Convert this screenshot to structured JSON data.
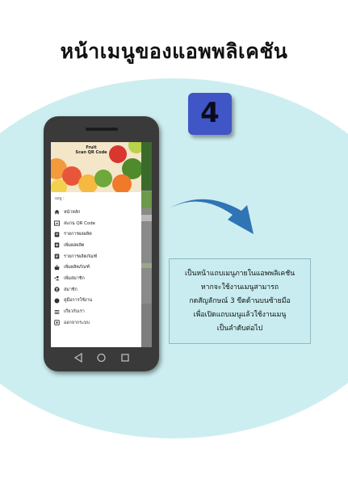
{
  "title": "หน้าเมนูของแอพพลิเคชัน",
  "step_number": "4",
  "colors": {
    "background": "#ffffff",
    "circle": "#cdeef0",
    "badge": "#4056c6",
    "arrow": "#2f74b5",
    "info_box": "#c8ecf0"
  },
  "phone": {
    "header_text": [
      "Fruit",
      "Scan QR Code"
    ],
    "menu_heading": "เมนู :",
    "menu_items": [
      {
        "label": "หน้าหลัก",
        "icon": "home-icon"
      },
      {
        "label": "สแกน QR Code",
        "icon": "qr-scan-icon"
      },
      {
        "label": "รายการผลผลิต",
        "icon": "list-icon"
      },
      {
        "label": "เพิ่มผลผลิต",
        "icon": "add-icon"
      },
      {
        "label": "รายการผลิตภัณฑ์",
        "icon": "product-list-icon"
      },
      {
        "label": "เพิ่มผลิตภัณฑ์",
        "icon": "basket-icon"
      },
      {
        "label": "เพิ่มสมาชิก",
        "icon": "add-member-icon"
      },
      {
        "label": "สมาชิก",
        "icon": "member-icon"
      },
      {
        "label": "คู่มือการใช้งาน",
        "icon": "manual-icon"
      },
      {
        "label": "เกี่ยวกับเรา",
        "icon": "about-icon"
      },
      {
        "label": "ออกจากระบบ",
        "icon": "logout-icon"
      }
    ]
  },
  "info_lines": [
    "เป็นหน้าแถบเมนูภายในแอพพลิเคชัน",
    "หากจะใช้งานเมนูสามารถ",
    "กดสัญลักษณ์ 3 ขีดด้านบนซ้ายมือ",
    "เพื่อเปิดแถบเมนูแล้วใช้งานเมนู",
    "เป็นลำดับต่อไป"
  ]
}
